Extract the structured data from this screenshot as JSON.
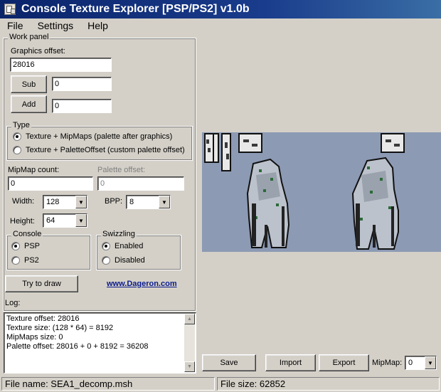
{
  "window": {
    "title": "Console Texture Explorer [PSP/PS2] v1.0b"
  },
  "menu": [
    "File",
    "Settings",
    "Help"
  ],
  "work_panel": {
    "title": "Work panel",
    "graphics_offset_label": "Graphics offset:",
    "graphics_offset_value": "28016",
    "sub_label": "Sub",
    "sub_value": "0",
    "add_label": "Add",
    "add_value": "0"
  },
  "type_group": {
    "title": "Type",
    "options": [
      {
        "label": "Texture + MipMaps (palette after graphics)",
        "selected": true
      },
      {
        "label": "Texture + PaletteOffset (custom palette offset)",
        "selected": false
      }
    ]
  },
  "mipmap_count": {
    "label": "MipMap count:",
    "value": "0"
  },
  "palette_offset": {
    "label": "Palette offset:",
    "value": "0"
  },
  "width": {
    "label": "Width:",
    "value": "128"
  },
  "bpp": {
    "label": "BPP:",
    "value": "8"
  },
  "height": {
    "label": "Height:",
    "value": "64"
  },
  "console_group": {
    "title": "Console",
    "options": [
      {
        "label": "PSP",
        "selected": true
      },
      {
        "label": "PS2",
        "selected": false
      }
    ]
  },
  "swizzling_group": {
    "title": "Swizzling",
    "options": [
      {
        "label": "Enabled",
        "selected": true
      },
      {
        "label": "Disabled",
        "selected": false
      }
    ]
  },
  "try_to_draw_label": "Try to draw",
  "website_link": "www.Dageron.com",
  "log": {
    "label": "Log:",
    "lines": [
      "Texture offset: 28016",
      "Texture size: (128 * 64) = 8192",
      "MipMaps size: 0",
      "Palette offset: 28016 + 0 + 8192 = 36208"
    ]
  },
  "bottom_toolbar": {
    "save_label": "Save",
    "import_label": "Import",
    "export_label": "Export",
    "mipmap_label": "MipMap:",
    "mipmap_value": "0"
  },
  "status": {
    "file_name": "File name: SEA1_decomp.msh",
    "file_size": "File size: 62852"
  },
  "colors": {
    "titlebar": "#0a246a",
    "window_bg": "#d4d0c8",
    "preview_bg": "#8c9ab4",
    "link": "#0a1a8c"
  },
  "icons": {
    "app": "app-window-icon",
    "dropdown": "chevron-down-icon",
    "scroll_up": "arrow-up-icon",
    "scroll_down": "arrow-down-icon"
  }
}
